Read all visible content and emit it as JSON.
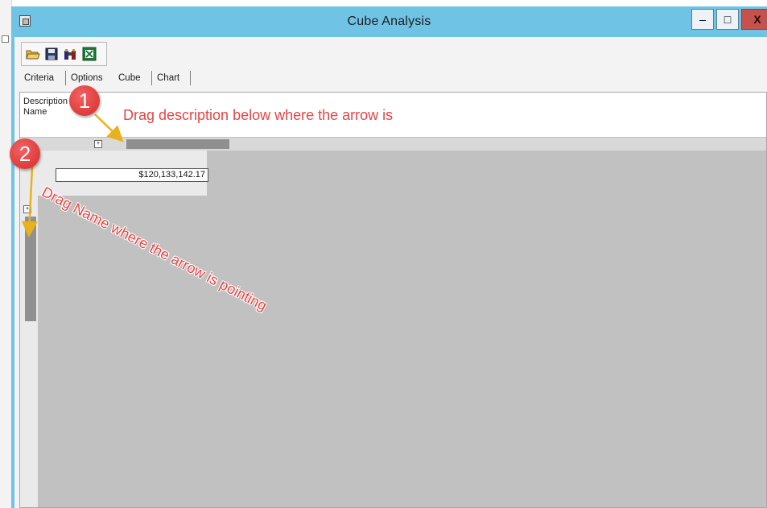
{
  "window": {
    "title": "Cube Analysis",
    "controls": {
      "minimize": "–",
      "maximize": "□",
      "close": "X"
    }
  },
  "toolbar": {
    "buttons": [
      {
        "icon": "open-folder-icon"
      },
      {
        "icon": "save-disk-icon"
      },
      {
        "icon": "binoculars-icon"
      },
      {
        "icon": "excel-export-icon"
      }
    ]
  },
  "tabs": [
    {
      "label": "Criteria"
    },
    {
      "label": "Options"
    },
    {
      "label": "Cube",
      "selected": true
    },
    {
      "label": "Chart"
    }
  ],
  "fields": {
    "description": "Description",
    "name": "Name"
  },
  "grid": {
    "total_value": "$120,133,142.17"
  },
  "annotations": {
    "step1_number": "1",
    "step1_text": "Drag description below where the arrow is",
    "step2_number": "2",
    "step2_text": "Drag Name where the arrow is pointing",
    "color": "#e64545"
  }
}
